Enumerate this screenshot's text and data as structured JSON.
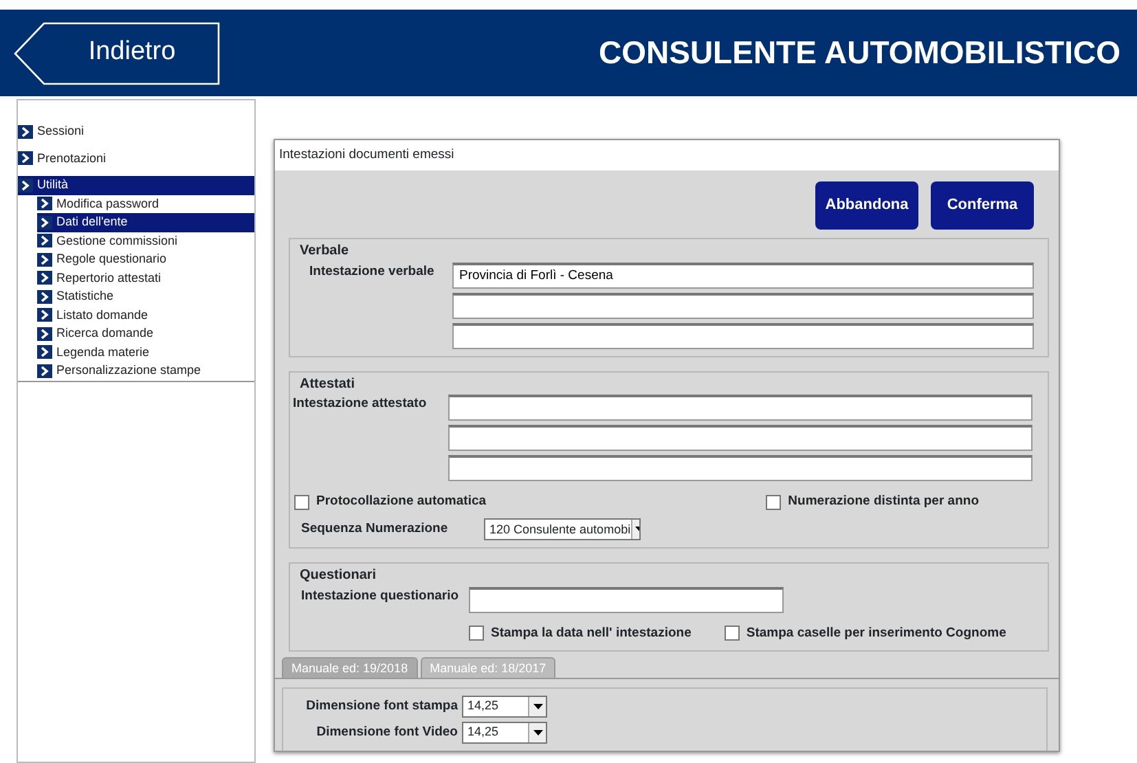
{
  "header": {
    "back_button": "Indietro",
    "title": "CONSULENTE AUTOMOBILISTICO"
  },
  "sidebar": {
    "items": [
      {
        "label": "Sessioni",
        "selected": false
      },
      {
        "label": "Prenotazioni",
        "selected": false
      },
      {
        "label": "Utilità",
        "selected": true,
        "children": [
          {
            "label": "Modifica password",
            "selected": false
          },
          {
            "label": "Dati dell'ente",
            "selected": true
          },
          {
            "label": "Gestione commissioni",
            "selected": false
          },
          {
            "label": "Regole questionario",
            "selected": false
          },
          {
            "label": "Repertorio attestati",
            "selected": false
          },
          {
            "label": "Statistiche",
            "selected": false
          },
          {
            "label": "Listato domande",
            "selected": false
          },
          {
            "label": "Ricerca domande",
            "selected": false
          },
          {
            "label": "Legenda materie",
            "selected": false
          },
          {
            "label": "Personalizzazione stampe",
            "selected": false
          }
        ]
      }
    ]
  },
  "dialog": {
    "title": "Intestazioni documenti emessi",
    "buttons": [
      "Abbandona",
      "Conferma"
    ],
    "verbale": {
      "legend": "Verbale",
      "label": "Intestazione verbale",
      "lines": [
        {
          "kind": "text",
          "value": "Provincia di Forlì - Cesena"
        },
        {
          "kind": "text"
        },
        {
          "kind": "text"
        }
      ]
    },
    "attestati": {
      "legend": "Attestati",
      "label": "Intestazione attestato",
      "lines": [
        {
          "kind": "text"
        },
        {
          "kind": "text"
        },
        {
          "kind": "text"
        }
      ],
      "checkboxes": [
        {
          "label": "Protocollazione automatica",
          "checked": false
        },
        {
          "label": "Numerazione distinta per anno",
          "checked": false
        }
      ],
      "sequence_label": "Sequenza Numerazione",
      "sequence_value": "120 Consulente automobi"
    },
    "questionari": {
      "legend": "Questionari",
      "label": "Intestazione questionario",
      "lines": [
        {
          "kind": "text"
        }
      ],
      "checkboxes": [
        {
          "label": "Stampa la data nell' intestazione",
          "checked": false
        },
        {
          "label": "Stampa caselle per inserimento Cognome",
          "checked": false
        }
      ]
    },
    "tabs": [
      {
        "label": "Manuale ed: 19/2018",
        "selected": true
      },
      {
        "label": "Manuale ed: 18/2017",
        "selected": false
      }
    ],
    "font_settings": [
      {
        "label": "Dimensione font stampa",
        "value": "14,25"
      },
      {
        "label": "Dimensione font Video",
        "value": "14,25"
      }
    ]
  }
}
